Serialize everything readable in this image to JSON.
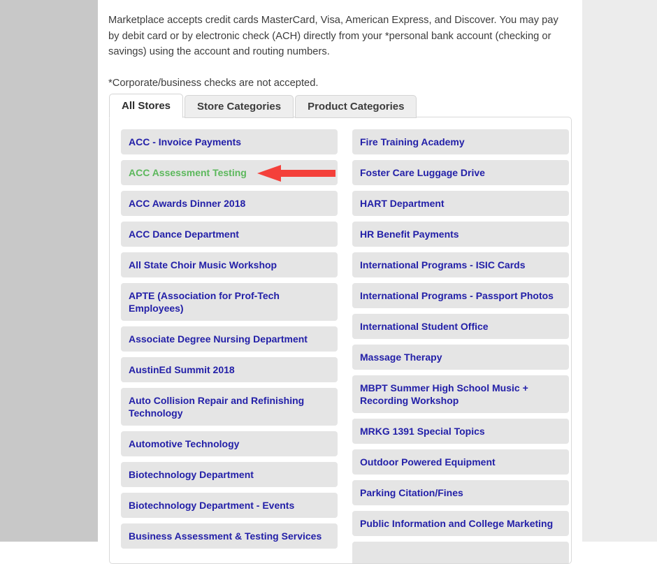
{
  "intro": {
    "paragraph_1": "Marketplace accepts credit cards MasterCard, Visa, American Express, and Discover. You may pay by debit card or by electronic check (ACH) directly from your *personal bank account (checking or savings) using the account and routing numbers.",
    "paragraph_2": "*Corporate/business checks are not accepted."
  },
  "tabs": [
    {
      "label": "All Stores",
      "active": true
    },
    {
      "label": "Store Categories",
      "active": false
    },
    {
      "label": "Product Categories",
      "active": false
    }
  ],
  "colors": {
    "link": "#2320a8",
    "visited_link": "#5cb85c",
    "item_background": "#e5e5e5",
    "annotation_arrow": "#f4403a",
    "page_gutter_left": "#c8c8c8",
    "page_gutter_right": "#ececec"
  },
  "annotation": {
    "type": "arrow",
    "direction": "left",
    "points_at": "ACC Assessment Testing",
    "color": "#f4403a"
  },
  "stores": {
    "left_column": [
      "ACC - Invoice Payments",
      "ACC Assessment Testing",
      "ACC Awards Dinner 2018",
      "ACC Dance Department",
      "All State Choir Music Workshop",
      "APTE (Association for Prof-Tech Employees)",
      "Associate Degree Nursing Department",
      "AustinEd Summit 2018",
      "Auto Collision Repair and Refinishing Technology",
      "Automotive Technology",
      "Biotechnology Department",
      "Biotechnology Department - Events",
      "Business Assessment & Testing Services"
    ],
    "right_column": [
      "Fire Training Academy",
      "Foster Care Luggage Drive",
      "HART Department",
      "HR Benefit Payments",
      "International Programs - ISIC Cards",
      "International Programs - Passport Photos",
      "International Student Office",
      "Massage Therapy",
      "MBPT Summer High School Music + Recording Workshop",
      "MRKG 1391 Special Topics",
      "Outdoor Powered Equipment",
      "Parking Citation/Fines",
      "Public Information and College Marketing",
      ""
    ],
    "visited": [
      "ACC Assessment Testing"
    ]
  }
}
